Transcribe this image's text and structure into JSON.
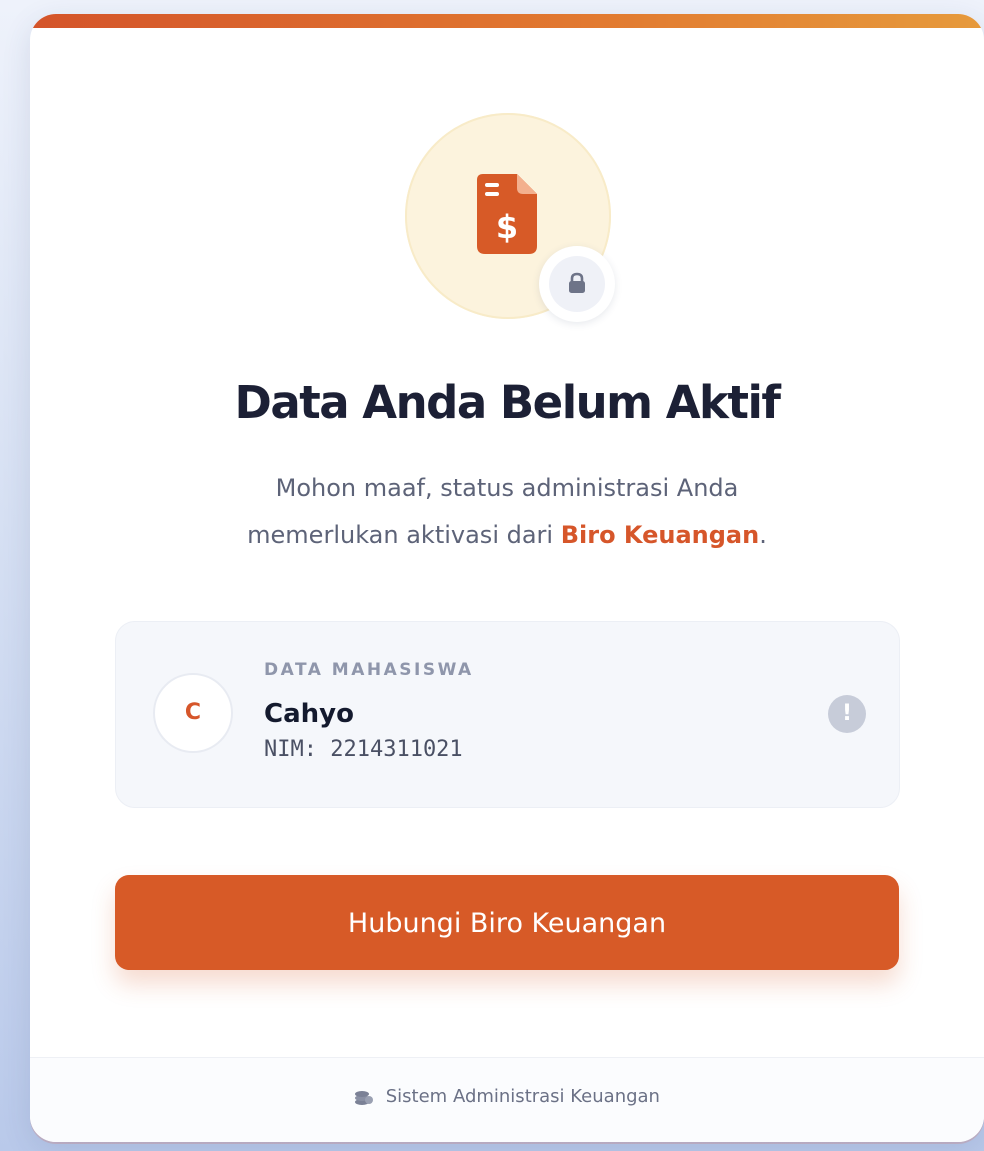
{
  "page": {
    "title": "Data Anda Belum Aktif",
    "subtitle_line1": "Mohon maaf, status administrasi Anda",
    "subtitle_line2_before": "memerlukan aktivasi dari ",
    "subtitle_highlight": "Biro Keuangan",
    "subtitle_line2_after": "."
  },
  "student": {
    "section_label": "DATA MAHASISWA",
    "avatar_initial": "C",
    "name": "Cahyo",
    "nim": "NIM: 2214311021",
    "status_icon": "!"
  },
  "actions": {
    "contact_label": "Hubungi Biro Keuangan"
  },
  "footer": {
    "label": "Sistem Administrasi Keuangan",
    "icon": "coins-icon"
  },
  "icons": {
    "main": "invoice-dollar-icon",
    "badge": "lock-icon"
  },
  "colors": {
    "accent": "#d75a27",
    "title": "#1c2035",
    "icon_bg": "#fcf3dd"
  }
}
